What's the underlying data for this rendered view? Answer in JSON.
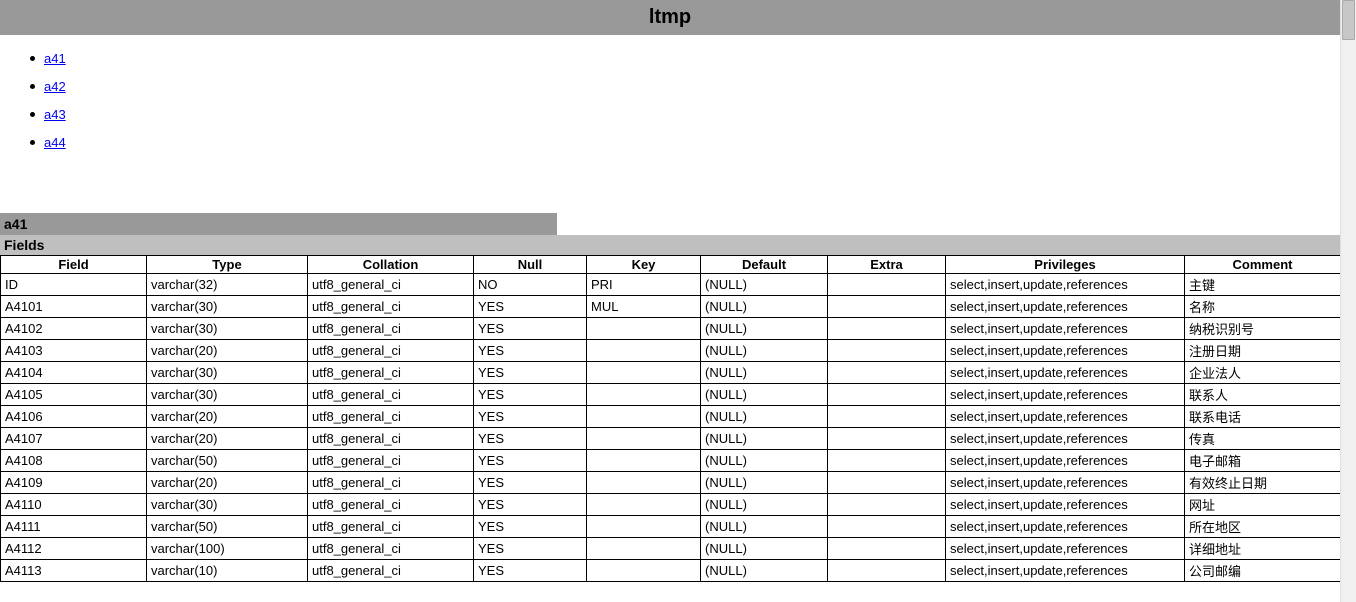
{
  "title": "ltmp",
  "nav": [
    "a41",
    "a42",
    "a43",
    "a44"
  ],
  "section": "a41",
  "fields_label": "Fields",
  "columns": [
    "Field",
    "Type",
    "Collation",
    "Null",
    "Key",
    "Default",
    "Extra",
    "Privileges",
    "Comment"
  ],
  "rows": [
    {
      "field": "ID",
      "type": "varchar(32)",
      "collation": "utf8_general_ci",
      "null": "NO",
      "key": "PRI",
      "default": "(NULL)",
      "extra": "",
      "priv": "select,insert,update,references",
      "comment": "主键"
    },
    {
      "field": "A4101",
      "type": "varchar(30)",
      "collation": "utf8_general_ci",
      "null": "YES",
      "key": "MUL",
      "default": "(NULL)",
      "extra": "",
      "priv": "select,insert,update,references",
      "comment": "名称"
    },
    {
      "field": "A4102",
      "type": "varchar(30)",
      "collation": "utf8_general_ci",
      "null": "YES",
      "key": "",
      "default": "(NULL)",
      "extra": "",
      "priv": "select,insert,update,references",
      "comment": "纳税识别号"
    },
    {
      "field": "A4103",
      "type": "varchar(20)",
      "collation": "utf8_general_ci",
      "null": "YES",
      "key": "",
      "default": "(NULL)",
      "extra": "",
      "priv": "select,insert,update,references",
      "comment": "注册日期"
    },
    {
      "field": "A4104",
      "type": "varchar(30)",
      "collation": "utf8_general_ci",
      "null": "YES",
      "key": "",
      "default": "(NULL)",
      "extra": "",
      "priv": "select,insert,update,references",
      "comment": "企业法人"
    },
    {
      "field": "A4105",
      "type": "varchar(30)",
      "collation": "utf8_general_ci",
      "null": "YES",
      "key": "",
      "default": "(NULL)",
      "extra": "",
      "priv": "select,insert,update,references",
      "comment": "联系人"
    },
    {
      "field": "A4106",
      "type": "varchar(20)",
      "collation": "utf8_general_ci",
      "null": "YES",
      "key": "",
      "default": "(NULL)",
      "extra": "",
      "priv": "select,insert,update,references",
      "comment": "联系电话"
    },
    {
      "field": "A4107",
      "type": "varchar(20)",
      "collation": "utf8_general_ci",
      "null": "YES",
      "key": "",
      "default": "(NULL)",
      "extra": "",
      "priv": "select,insert,update,references",
      "comment": "传真"
    },
    {
      "field": "A4108",
      "type": "varchar(50)",
      "collation": "utf8_general_ci",
      "null": "YES",
      "key": "",
      "default": "(NULL)",
      "extra": "",
      "priv": "select,insert,update,references",
      "comment": "电子邮箱"
    },
    {
      "field": "A4109",
      "type": "varchar(20)",
      "collation": "utf8_general_ci",
      "null": "YES",
      "key": "",
      "default": "(NULL)",
      "extra": "",
      "priv": "select,insert,update,references",
      "comment": "有效终止日期"
    },
    {
      "field": "A4110",
      "type": "varchar(30)",
      "collation": "utf8_general_ci",
      "null": "YES",
      "key": "",
      "default": "(NULL)",
      "extra": "",
      "priv": "select,insert,update,references",
      "comment": "网址"
    },
    {
      "field": "A4111",
      "type": "varchar(50)",
      "collation": "utf8_general_ci",
      "null": "YES",
      "key": "",
      "default": "(NULL)",
      "extra": "",
      "priv": "select,insert,update,references",
      "comment": "所在地区"
    },
    {
      "field": "A4112",
      "type": "varchar(100)",
      "collation": "utf8_general_ci",
      "null": "YES",
      "key": "",
      "default": "(NULL)",
      "extra": "",
      "priv": "select,insert,update,references",
      "comment": "详细地址"
    },
    {
      "field": "A4113",
      "type": "varchar(10)",
      "collation": "utf8_general_ci",
      "null": "YES",
      "key": "",
      "default": "(NULL)",
      "extra": "",
      "priv": "select,insert,update,references",
      "comment": "公司邮编"
    }
  ]
}
